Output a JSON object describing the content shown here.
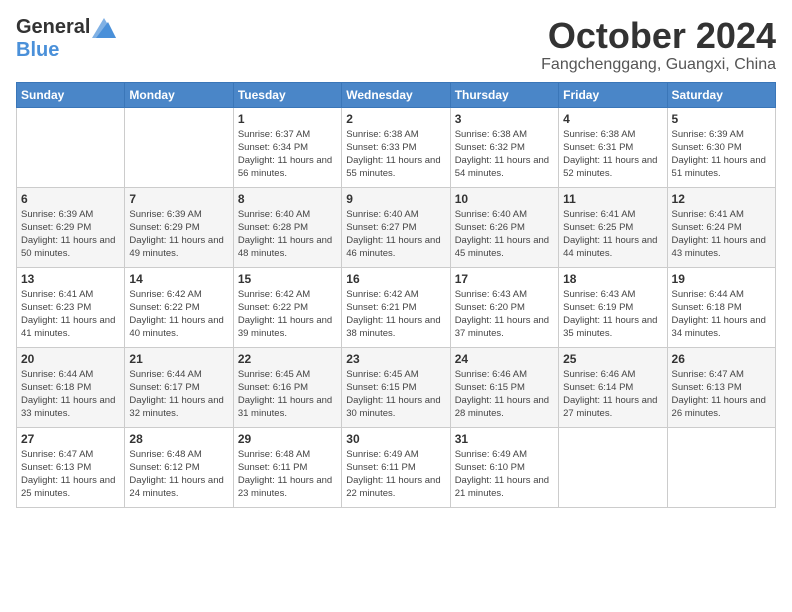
{
  "header": {
    "logo_general": "General",
    "logo_blue": "Blue",
    "month": "October 2024",
    "location": "Fangchenggang, Guangxi, China"
  },
  "days_of_week": [
    "Sunday",
    "Monday",
    "Tuesday",
    "Wednesday",
    "Thursday",
    "Friday",
    "Saturday"
  ],
  "weeks": [
    [
      {
        "day": "",
        "info": ""
      },
      {
        "day": "",
        "info": ""
      },
      {
        "day": "1",
        "info": "Sunrise: 6:37 AM\nSunset: 6:34 PM\nDaylight: 11 hours and 56 minutes."
      },
      {
        "day": "2",
        "info": "Sunrise: 6:38 AM\nSunset: 6:33 PM\nDaylight: 11 hours and 55 minutes."
      },
      {
        "day": "3",
        "info": "Sunrise: 6:38 AM\nSunset: 6:32 PM\nDaylight: 11 hours and 54 minutes."
      },
      {
        "day": "4",
        "info": "Sunrise: 6:38 AM\nSunset: 6:31 PM\nDaylight: 11 hours and 52 minutes."
      },
      {
        "day": "5",
        "info": "Sunrise: 6:39 AM\nSunset: 6:30 PM\nDaylight: 11 hours and 51 minutes."
      }
    ],
    [
      {
        "day": "6",
        "info": "Sunrise: 6:39 AM\nSunset: 6:29 PM\nDaylight: 11 hours and 50 minutes."
      },
      {
        "day": "7",
        "info": "Sunrise: 6:39 AM\nSunset: 6:29 PM\nDaylight: 11 hours and 49 minutes."
      },
      {
        "day": "8",
        "info": "Sunrise: 6:40 AM\nSunset: 6:28 PM\nDaylight: 11 hours and 48 minutes."
      },
      {
        "day": "9",
        "info": "Sunrise: 6:40 AM\nSunset: 6:27 PM\nDaylight: 11 hours and 46 minutes."
      },
      {
        "day": "10",
        "info": "Sunrise: 6:40 AM\nSunset: 6:26 PM\nDaylight: 11 hours and 45 minutes."
      },
      {
        "day": "11",
        "info": "Sunrise: 6:41 AM\nSunset: 6:25 PM\nDaylight: 11 hours and 44 minutes."
      },
      {
        "day": "12",
        "info": "Sunrise: 6:41 AM\nSunset: 6:24 PM\nDaylight: 11 hours and 43 minutes."
      }
    ],
    [
      {
        "day": "13",
        "info": "Sunrise: 6:41 AM\nSunset: 6:23 PM\nDaylight: 11 hours and 41 minutes."
      },
      {
        "day": "14",
        "info": "Sunrise: 6:42 AM\nSunset: 6:22 PM\nDaylight: 11 hours and 40 minutes."
      },
      {
        "day": "15",
        "info": "Sunrise: 6:42 AM\nSunset: 6:22 PM\nDaylight: 11 hours and 39 minutes."
      },
      {
        "day": "16",
        "info": "Sunrise: 6:42 AM\nSunset: 6:21 PM\nDaylight: 11 hours and 38 minutes."
      },
      {
        "day": "17",
        "info": "Sunrise: 6:43 AM\nSunset: 6:20 PM\nDaylight: 11 hours and 37 minutes."
      },
      {
        "day": "18",
        "info": "Sunrise: 6:43 AM\nSunset: 6:19 PM\nDaylight: 11 hours and 35 minutes."
      },
      {
        "day": "19",
        "info": "Sunrise: 6:44 AM\nSunset: 6:18 PM\nDaylight: 11 hours and 34 minutes."
      }
    ],
    [
      {
        "day": "20",
        "info": "Sunrise: 6:44 AM\nSunset: 6:18 PM\nDaylight: 11 hours and 33 minutes."
      },
      {
        "day": "21",
        "info": "Sunrise: 6:44 AM\nSunset: 6:17 PM\nDaylight: 11 hours and 32 minutes."
      },
      {
        "day": "22",
        "info": "Sunrise: 6:45 AM\nSunset: 6:16 PM\nDaylight: 11 hours and 31 minutes."
      },
      {
        "day": "23",
        "info": "Sunrise: 6:45 AM\nSunset: 6:15 PM\nDaylight: 11 hours and 30 minutes."
      },
      {
        "day": "24",
        "info": "Sunrise: 6:46 AM\nSunset: 6:15 PM\nDaylight: 11 hours and 28 minutes."
      },
      {
        "day": "25",
        "info": "Sunrise: 6:46 AM\nSunset: 6:14 PM\nDaylight: 11 hours and 27 minutes."
      },
      {
        "day": "26",
        "info": "Sunrise: 6:47 AM\nSunset: 6:13 PM\nDaylight: 11 hours and 26 minutes."
      }
    ],
    [
      {
        "day": "27",
        "info": "Sunrise: 6:47 AM\nSunset: 6:13 PM\nDaylight: 11 hours and 25 minutes."
      },
      {
        "day": "28",
        "info": "Sunrise: 6:48 AM\nSunset: 6:12 PM\nDaylight: 11 hours and 24 minutes."
      },
      {
        "day": "29",
        "info": "Sunrise: 6:48 AM\nSunset: 6:11 PM\nDaylight: 11 hours and 23 minutes."
      },
      {
        "day": "30",
        "info": "Sunrise: 6:49 AM\nSunset: 6:11 PM\nDaylight: 11 hours and 22 minutes."
      },
      {
        "day": "31",
        "info": "Sunrise: 6:49 AM\nSunset: 6:10 PM\nDaylight: 11 hours and 21 minutes."
      },
      {
        "day": "",
        "info": ""
      },
      {
        "day": "",
        "info": ""
      }
    ]
  ]
}
